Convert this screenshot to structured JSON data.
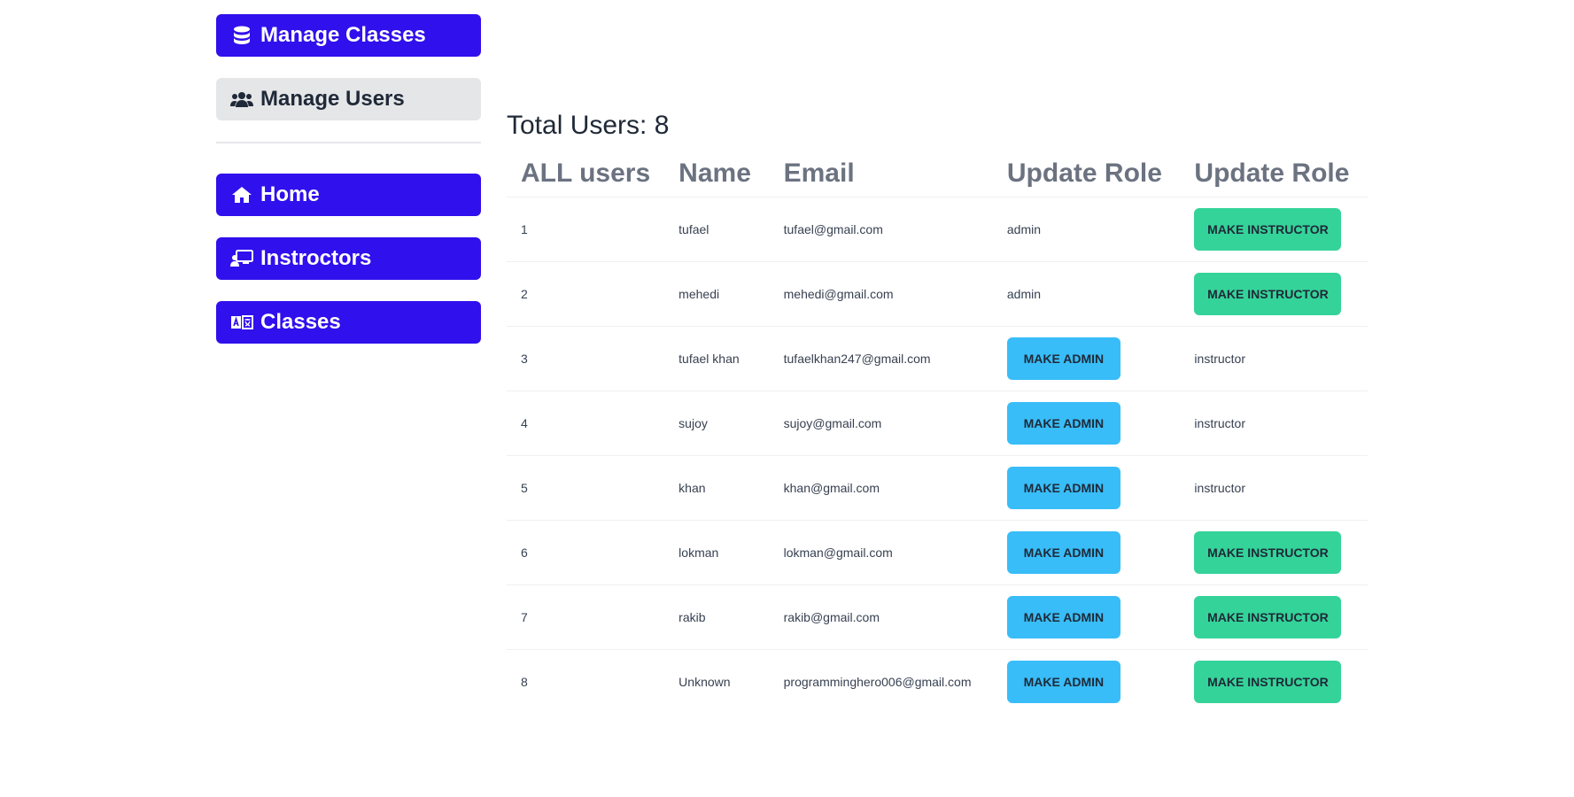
{
  "sidebar": {
    "items": [
      {
        "label": "Manage Classes",
        "icon": "database-icon",
        "style": "primary"
      },
      {
        "label": "Manage Users",
        "icon": "users-icon",
        "style": "secondary"
      }
    ],
    "links": [
      {
        "label": "Home",
        "icon": "home-icon"
      },
      {
        "label": "Instroctors",
        "icon": "chalkboard-user-icon"
      },
      {
        "label": "Classes",
        "icon": "language-icon"
      }
    ]
  },
  "main": {
    "total_label": "Total Users: 8",
    "headers": [
      "ALL users",
      "Name",
      "Email",
      "Update Role",
      "Update Role"
    ],
    "make_admin_label": "MAKE ADMIN",
    "make_instructor_label": "MAKE INSTRUCTOR",
    "rows": [
      {
        "index": "1",
        "name": "tufael",
        "email": "tufael@gmail.com",
        "role_col1": "admin",
        "role_col2": null
      },
      {
        "index": "2",
        "name": "mehedi",
        "email": "mehedi@gmail.com",
        "role_col1": "admin",
        "role_col2": null
      },
      {
        "index": "3",
        "name": "tufael khan",
        "email": "tufaelkhan247@gmail.com",
        "role_col1": null,
        "role_col2": "instructor"
      },
      {
        "index": "4",
        "name": "sujoy",
        "email": "sujoy@gmail.com",
        "role_col1": null,
        "role_col2": "instructor"
      },
      {
        "index": "5",
        "name": "khan",
        "email": "khan@gmail.com",
        "role_col1": null,
        "role_col2": "instructor"
      },
      {
        "index": "6",
        "name": "lokman",
        "email": "lokman@gmail.com",
        "role_col1": null,
        "role_col2": null
      },
      {
        "index": "7",
        "name": "rakib",
        "email": "rakib@gmail.com",
        "role_col1": null,
        "role_col2": null
      },
      {
        "index": "8",
        "name": "Unknown",
        "email": "programminghero006@gmail.com",
        "role_col1": null,
        "role_col2": null
      }
    ]
  },
  "colors": {
    "primary": "#3010ec",
    "secondary_bg": "#e5e6e8",
    "admin_button": "#38bdf8",
    "instructor_button": "#34d399",
    "header_text": "#6b7280"
  }
}
